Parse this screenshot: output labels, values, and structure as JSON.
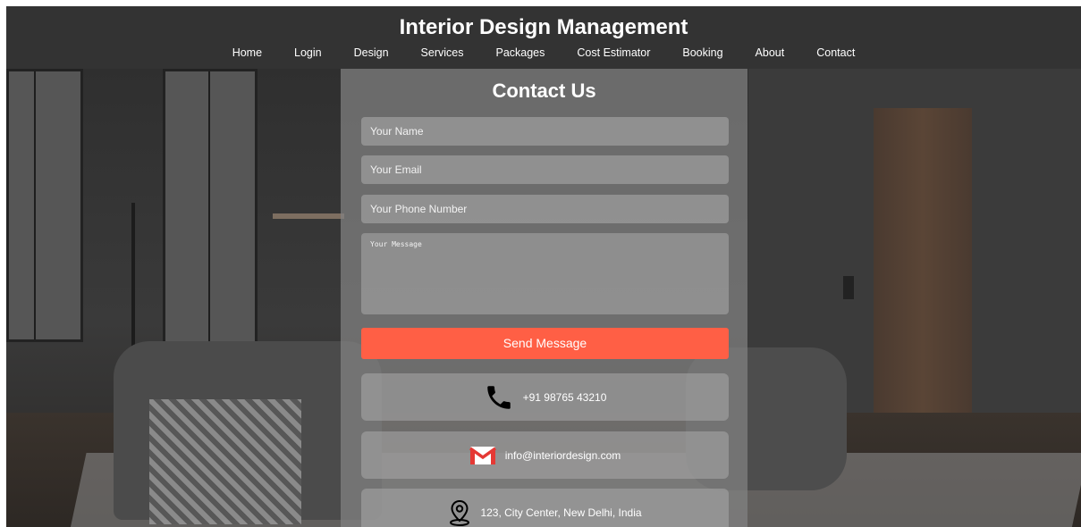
{
  "header": {
    "title": "Interior Design Management",
    "nav": [
      "Home",
      "Login",
      "Design",
      "Services",
      "Packages",
      "Cost Estimator",
      "Booking",
      "About",
      "Contact"
    ]
  },
  "contact": {
    "title": "Contact Us",
    "fields": {
      "name_placeholder": "Your Name",
      "email_placeholder": "Your Email",
      "phone_placeholder": "Your Phone Number",
      "message_placeholder": "Your Message"
    },
    "send_label": "Send Message",
    "info": {
      "phone": "+91 98765 43210",
      "email": "info@interiordesign.com",
      "address": "123, City Center, New Delhi, India"
    }
  },
  "colors": {
    "header_bg": "#333333",
    "accent": "#ff5f45",
    "mail_red": "#e53935"
  },
  "icons": [
    "phone-icon",
    "mail-icon",
    "location-pin-icon"
  ]
}
